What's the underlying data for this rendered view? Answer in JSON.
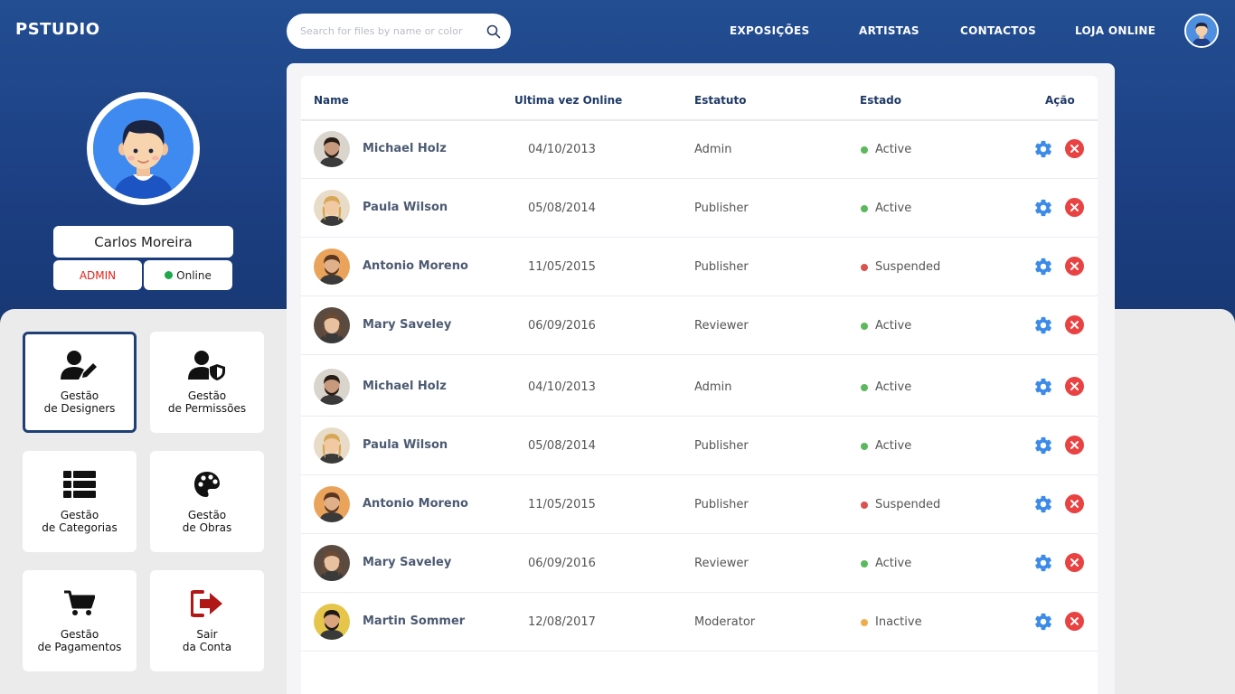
{
  "brand": {
    "logo": "PSTUDIO"
  },
  "search": {
    "placeholder": "Search for files by name or color",
    "icon": "search-icon"
  },
  "nav": {
    "items": [
      {
        "label": "EXPOSIÇÕES"
      },
      {
        "label": "ARTISTAS"
      },
      {
        "label": "CONTACTOS"
      },
      {
        "label": "LOJA ONLINE"
      }
    ]
  },
  "profile": {
    "name": "Carlos Moreira",
    "role": "ADMIN",
    "status": "Online",
    "status_color": "#1fa84a"
  },
  "menu": {
    "tiles": [
      {
        "label": "Gestão\nde Designers",
        "icon": "user-edit-icon",
        "active": true
      },
      {
        "label": "Gestão\nde Permissões",
        "icon": "user-shield-icon",
        "active": false
      },
      {
        "label": "Gestão\nde Categorias",
        "icon": "list-icon",
        "active": false
      },
      {
        "label": "Gestão\nde Obras",
        "icon": "palette-icon",
        "active": false
      },
      {
        "label": "Gestão\nde Pagamentos",
        "icon": "shopping-cart-icon",
        "active": false
      },
      {
        "label": "Sair\nda Conta",
        "icon": "sign-out-icon",
        "active": false
      }
    ]
  },
  "table": {
    "headers": {
      "name": "Name",
      "last_online": "Ultima vez Online",
      "role": "Estatuto",
      "state": "Estado",
      "action": "Ação"
    },
    "rows": [
      {
        "name": "Michael Holz",
        "date": "04/10/2013",
        "role": "Admin",
        "state": "Active",
        "state_color": "#5cb85c"
      },
      {
        "name": "Paula Wilson",
        "date": "05/08/2014",
        "role": "Publisher",
        "state": "Active",
        "state_color": "#5cb85c"
      },
      {
        "name": "Antonio Moreno",
        "date": "11/05/2015",
        "role": "Publisher",
        "state": "Suspended",
        "state_color": "#d9534f"
      },
      {
        "name": "Mary Saveley",
        "date": "06/09/2016",
        "role": "Reviewer",
        "state": "Active",
        "state_color": "#5cb85c"
      },
      {
        "name": "Michael Holz",
        "date": "04/10/2013",
        "role": "Admin",
        "state": "Active",
        "state_color": "#5cb85c"
      },
      {
        "name": "Paula Wilson",
        "date": "05/08/2014",
        "role": "Publisher",
        "state": "Active",
        "state_color": "#5cb85c"
      },
      {
        "name": "Antonio Moreno",
        "date": "11/05/2015",
        "role": "Publisher",
        "state": "Suspended",
        "state_color": "#d9534f"
      },
      {
        "name": "Mary Saveley",
        "date": "06/09/2016",
        "role": "Reviewer",
        "state": "Active",
        "state_color": "#5cb85c"
      },
      {
        "name": "Martin Sommer",
        "date": "12/08/2017",
        "role": "Moderator",
        "state": "Inactive",
        "state_color": "#f0ad4e"
      }
    ]
  },
  "colors": {
    "header_blue": "#234e92",
    "accent_blue": "#3d8be8",
    "delete_red": "#e94242",
    "table_header_text": "#1f3a66"
  }
}
